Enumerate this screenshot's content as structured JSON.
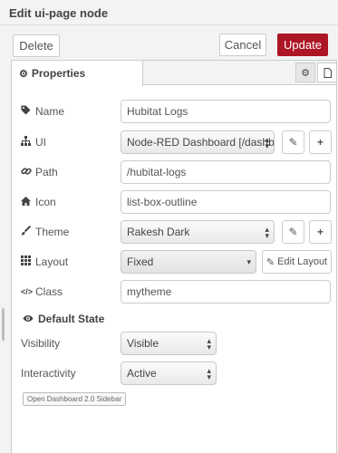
{
  "header": {
    "title": "Edit ui-page node"
  },
  "toolbar": {
    "delete_label": "Delete",
    "cancel_label": "Cancel",
    "update_label": "Update"
  },
  "tabs": {
    "properties_label": "Properties"
  },
  "fields": {
    "name": {
      "label": "Name",
      "value": "Hubitat Logs"
    },
    "ui": {
      "label": "UI",
      "value": "Node-RED Dashboard [/dashboa"
    },
    "path": {
      "label": "Path",
      "value": "/hubitat-logs"
    },
    "icon": {
      "label": "Icon",
      "value": "list-box-outline"
    },
    "theme": {
      "label": "Theme",
      "value": "Rakesh Dark"
    },
    "layout": {
      "label": "Layout",
      "value": "Fixed",
      "edit_label": "Edit Layout"
    },
    "class": {
      "label": "Class",
      "value": "mytheme"
    }
  },
  "default_state": {
    "title": "Default State",
    "visibility": {
      "label": "Visibility",
      "value": "Visible"
    },
    "interactivity": {
      "label": "Interactivity",
      "value": "Active"
    }
  },
  "sidebar_button": "Open Dashboard 2.0 Sidebar"
}
